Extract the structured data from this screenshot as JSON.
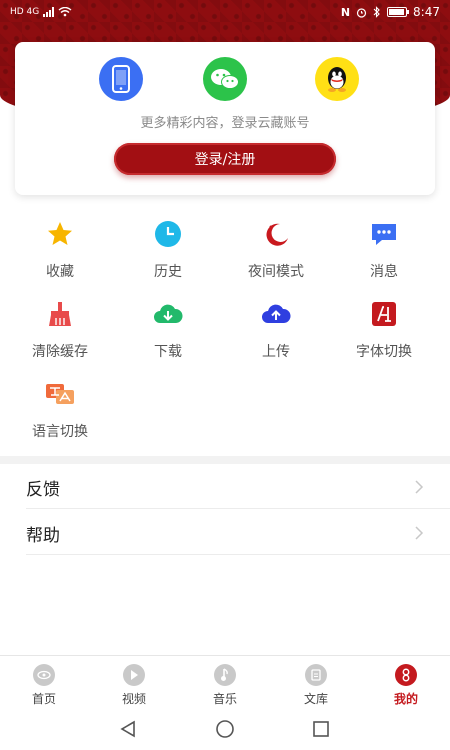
{
  "status_bar": {
    "left_text": "HD 4G",
    "time": "8:47"
  },
  "login_card": {
    "social": [
      {
        "icon": "phone-icon",
        "color": "#3b6ff3"
      },
      {
        "icon": "wechat-icon",
        "color": "#2cc34a"
      },
      {
        "icon": "qq-icon",
        "color": "#ffe015"
      }
    ],
    "hint": "更多精彩内容，登录云藏账号",
    "login_button": "登录/注册"
  },
  "features": [
    {
      "label": "收藏",
      "icon": "star-icon"
    },
    {
      "label": "历史",
      "icon": "clock-icon"
    },
    {
      "label": "夜间模式",
      "icon": "moon-icon"
    },
    {
      "label": "消息",
      "icon": "message-icon"
    },
    {
      "label": "清除缓存",
      "icon": "broom-icon"
    },
    {
      "label": "下载",
      "icon": "download-icon"
    },
    {
      "label": "上传",
      "icon": "upload-icon"
    },
    {
      "label": "字体切换",
      "icon": "font-icon"
    },
    {
      "label": "语言切换",
      "icon": "language-icon"
    }
  ],
  "list": [
    {
      "label": "反馈"
    },
    {
      "label": "帮助"
    }
  ],
  "bottom_nav": [
    {
      "label": "首页",
      "icon": "home-icon",
      "active": false
    },
    {
      "label": "视频",
      "icon": "video-icon",
      "active": false
    },
    {
      "label": "音乐",
      "icon": "music-icon",
      "active": false
    },
    {
      "label": "文库",
      "icon": "library-icon",
      "active": false
    },
    {
      "label": "我的",
      "icon": "profile-icon",
      "active": true
    }
  ],
  "colors": {
    "brand_red": "#a20f13",
    "active_tab": "#c41a1f"
  }
}
